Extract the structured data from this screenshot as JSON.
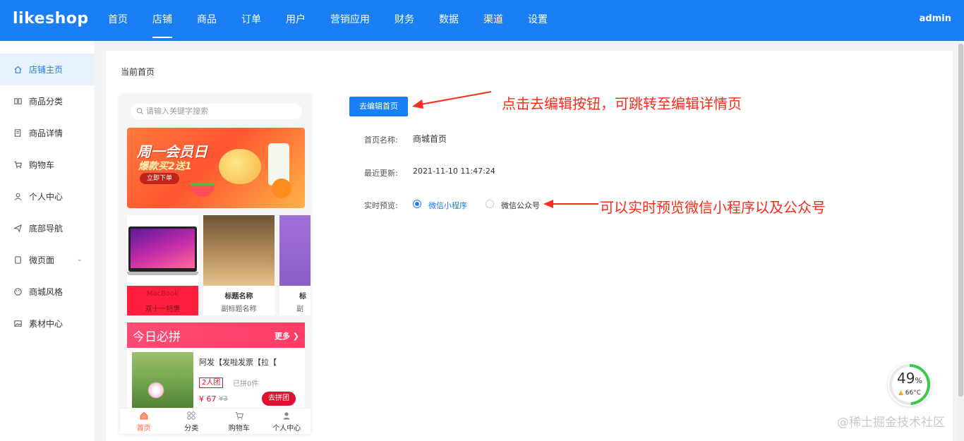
{
  "brand": {
    "logo": "likeshop",
    "accent": "#1a7ef5",
    "annotation_color": "#ff2a1a"
  },
  "topnav": {
    "items": [
      {
        "label": "首页",
        "active": false
      },
      {
        "label": "店铺",
        "active": true
      },
      {
        "label": "商品",
        "active": false
      },
      {
        "label": "订单",
        "active": false
      },
      {
        "label": "用户",
        "active": false
      },
      {
        "label": "营销应用",
        "active": false
      },
      {
        "label": "财务",
        "active": false
      },
      {
        "label": "数据",
        "active": false
      },
      {
        "label": "渠道",
        "active": false
      },
      {
        "label": "设置",
        "active": false
      }
    ],
    "user": "admin"
  },
  "sidebar": {
    "items": [
      {
        "label": "店铺主页",
        "icon": "home-icon",
        "active": true
      },
      {
        "label": "商品分类",
        "icon": "category-icon"
      },
      {
        "label": "商品详情",
        "icon": "detail-icon"
      },
      {
        "label": "购物车",
        "icon": "cart-icon"
      },
      {
        "label": "个人中心",
        "icon": "user-icon"
      },
      {
        "label": "底部导航",
        "icon": "send-icon"
      },
      {
        "label": "微页面",
        "icon": "page-icon",
        "expandable": true
      },
      {
        "label": "商城风格",
        "icon": "palette-icon"
      },
      {
        "label": "素材中心",
        "icon": "image-icon"
      }
    ]
  },
  "main": {
    "title": "当前首页",
    "edit_button": "去编辑首页",
    "fields": {
      "name_label": "首页名称:",
      "name_value": "商城首页",
      "updated_label": "最近更新:",
      "updated_value": "2021-11-10 11:47:24",
      "preview_label": "实时预览:",
      "preview_options": [
        {
          "label": "微信小程序",
          "selected": true
        },
        {
          "label": "微信公众号",
          "selected": false
        }
      ]
    },
    "annotations": [
      "点击去编辑按钮，可跳转至编辑详情页",
      "可以实时预览微信小程序以及公众号"
    ]
  },
  "phone": {
    "search_placeholder": "请输入关键字搜索",
    "banner": {
      "line1": "周一会员日",
      "line2": "爆款买2送1",
      "button": "立即下单"
    },
    "cards": [
      {
        "title": "MacBook",
        "subtitle": "双十一特惠"
      },
      {
        "title": "标题名称",
        "subtitle": "副标题名称"
      },
      {
        "title": "标",
        "subtitle": "副"
      }
    ],
    "groupbuy": {
      "title": "今日必拼",
      "more": "更多",
      "item": {
        "name": "阿发【发啦发票【拉【",
        "tag": "2人团",
        "sold": "已拼0件",
        "price": "¥ 67",
        "old_price": "¥3",
        "button": "去拼团"
      }
    },
    "tabbar": [
      {
        "label": "首页",
        "active": true
      },
      {
        "label": "分类"
      },
      {
        "label": "购物车"
      },
      {
        "label": "个人中心"
      }
    ]
  },
  "widget": {
    "percent": "49",
    "percent_unit": "%",
    "temp": "66°C"
  },
  "watermark": "@稀土掘金技术社区"
}
